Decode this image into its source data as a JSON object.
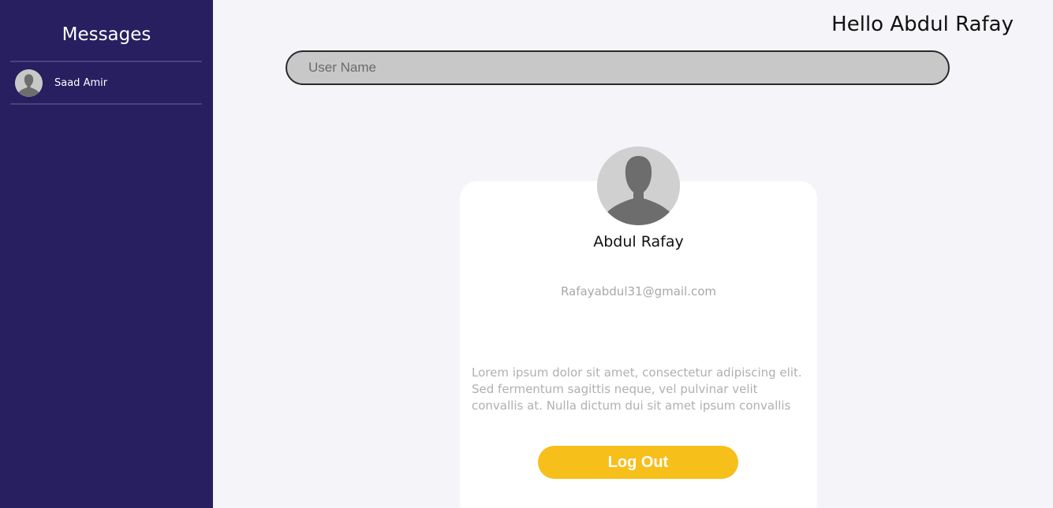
{
  "sidebar": {
    "title": "Messages",
    "contacts": [
      {
        "name": "Saad Amir",
        "avatar_icon": "user-avatar-icon"
      }
    ]
  },
  "header": {
    "greeting": "Hello Abdul Rafay"
  },
  "search": {
    "placeholder": "User Name",
    "value": ""
  },
  "profile": {
    "avatar_icon": "user-avatar-icon",
    "name": "Abdul Rafay",
    "email": "Rafayabdul31@gmail.com",
    "bio": "Lorem ipsum dolor sit amet, consectetur adipiscing elit. Sed fermentum sagittis neque, vel pulvinar velit convallis at. Nulla dictum dui sit amet ipsum convallis",
    "logout_label": "Log Out"
  },
  "colors": {
    "sidebar_bg": "#271f60",
    "page_bg": "#f4f4f9",
    "search_bg": "#c8c8c8",
    "logout_bg": "#f7bf1a",
    "avatar_bg": "#d0d0d0",
    "avatar_silhouette": "#6d6d6d"
  }
}
